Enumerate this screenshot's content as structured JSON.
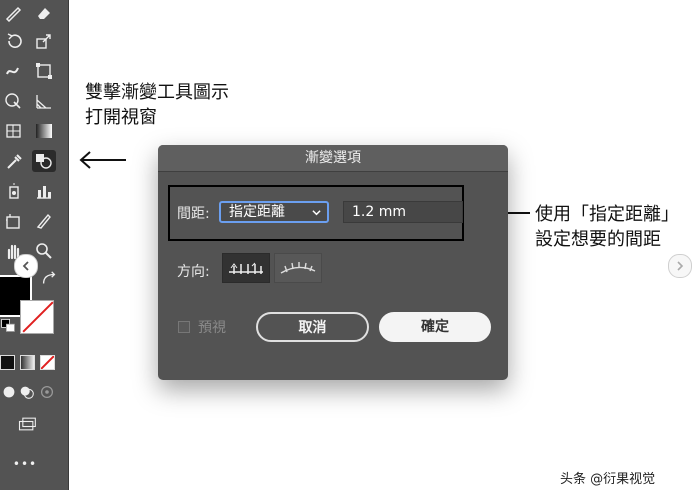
{
  "annotations": {
    "top_line1": "雙擊漸變工具圖示",
    "top_line2": "打開視窗",
    "right_line1": "使用「指定距離」",
    "right_line2": "設定想要的間距"
  },
  "dialog": {
    "title": "漸變選項",
    "spacing_label": "間距:",
    "spacing_selected": "指定距離",
    "spacing_value": "1.2 mm",
    "orientation_label": "方向:",
    "preview_label": "預視",
    "cancel_label": "取消",
    "ok_label": "確定"
  },
  "toolbar": {
    "more_label": "•••"
  },
  "colors": {
    "toolbar_bg": "#535353",
    "dialog_bg": "#535353",
    "select_focus": "#6b9ff0",
    "none_swatch": "#e02020"
  },
  "watermark": "头条 @衍果视觉"
}
